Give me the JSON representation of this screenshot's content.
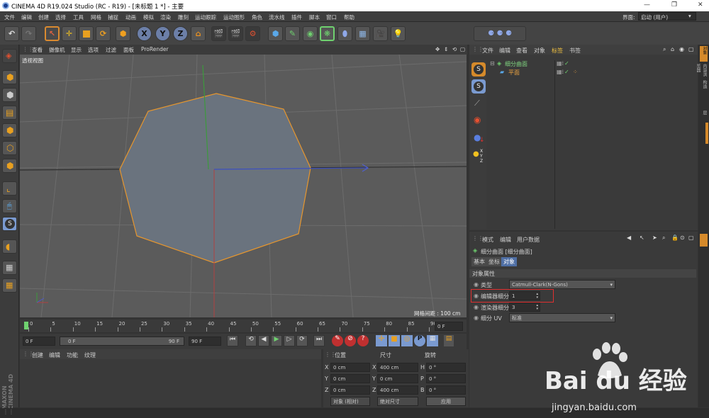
{
  "window": {
    "title": "CINEMA 4D R19.024 Studio (RC - R19) - [未标题 1 *] - 主要"
  },
  "menu": [
    "文件",
    "编辑",
    "创建",
    "选择",
    "工具",
    "网格",
    "捕捉",
    "动画",
    "模拟",
    "渲染",
    "雕刻",
    "运动跟踪",
    "运动图形",
    "角色",
    "流水线",
    "插件",
    "脚本",
    "窗口",
    "帮助"
  ],
  "layout": {
    "label": "界面:",
    "value": "启动 (用户)"
  },
  "toolbar_icons": [
    "undo-icon",
    "redo-icon",
    "select-icon",
    "move-icon",
    "scale-icon",
    "rotate-icon",
    "object-icon",
    "x-axis-icon",
    "y-axis-icon",
    "z-axis-icon",
    "coord-icon",
    "render-region-icon",
    "render-view-icon",
    "render-settings-icon",
    "cube-icon",
    "pen-icon",
    "subdivision-icon",
    "array-icon",
    "deformer-icon",
    "floor-icon",
    "camera-icon",
    "light-icon"
  ],
  "axis": {
    "x": "X",
    "y": "Y",
    "z": "Z"
  },
  "viewport": {
    "menu": [
      "查看",
      "摄像机",
      "显示",
      "选项",
      "过滤",
      "面板",
      "ProRender"
    ],
    "label": "透视视图",
    "grid_spacing": "网格间距 : 100 cm"
  },
  "timeline": {
    "ticks": [
      "0",
      "5",
      "10",
      "15",
      "20",
      "25",
      "30",
      "35",
      "40",
      "45",
      "50",
      "55",
      "60",
      "65",
      "70",
      "75",
      "80",
      "85",
      "90"
    ],
    "frame_end": "0 F"
  },
  "transport": {
    "start": "0 F",
    "current": "0 F",
    "end": "90 F",
    "max": "90 F"
  },
  "materials": {
    "menu": [
      "创建",
      "编辑",
      "功能",
      "纹理"
    ]
  },
  "coords": {
    "headers": [
      "位置",
      "尺寸",
      "旋转"
    ],
    "rows": [
      {
        "a": "X",
        "pos": "0 cm",
        "s": "X",
        "size": "400 cm",
        "r": "H",
        "rot": "0 °"
      },
      {
        "a": "Y",
        "pos": "0 cm",
        "s": "Y",
        "size": "0 cm",
        "r": "P",
        "rot": "0 °"
      },
      {
        "a": "Z",
        "pos": "0 cm",
        "s": "Z",
        "size": "400 cm",
        "r": "B",
        "rot": "0 °"
      }
    ],
    "mode": "对象 (相对)",
    "size_mode": "绝对尺寸",
    "apply": "应用"
  },
  "objects": {
    "menu": [
      "文件",
      "编辑",
      "查看",
      "对象",
      "标签",
      "书签"
    ],
    "items": [
      {
        "name": "细分曲面",
        "color": "#7fd27f"
      },
      {
        "name": "平面",
        "color": "#e8a040"
      }
    ]
  },
  "attributes": {
    "menu": [
      "模式",
      "编辑",
      "用户数据"
    ],
    "title": "细分曲面 [细分曲面]",
    "tabs": [
      "基本",
      "坐标",
      "对象"
    ],
    "section": "对象属性",
    "fields": [
      {
        "label": "类型",
        "value": "Catmull-Clark(N-Gons)"
      },
      {
        "label": "编辑器细分",
        "value": "1"
      },
      {
        "label": "渲染器细分",
        "value": "3"
      },
      {
        "label": "细分 UV",
        "value": "标准"
      }
    ]
  },
  "side_tabs": [
    "对象",
    "内容浏览器",
    "构造",
    "层"
  ],
  "brand": "MAXON CINEMA 4D",
  "watermark": {
    "logo": "Bai du 经验",
    "url": "jingyan.baidu.com"
  }
}
